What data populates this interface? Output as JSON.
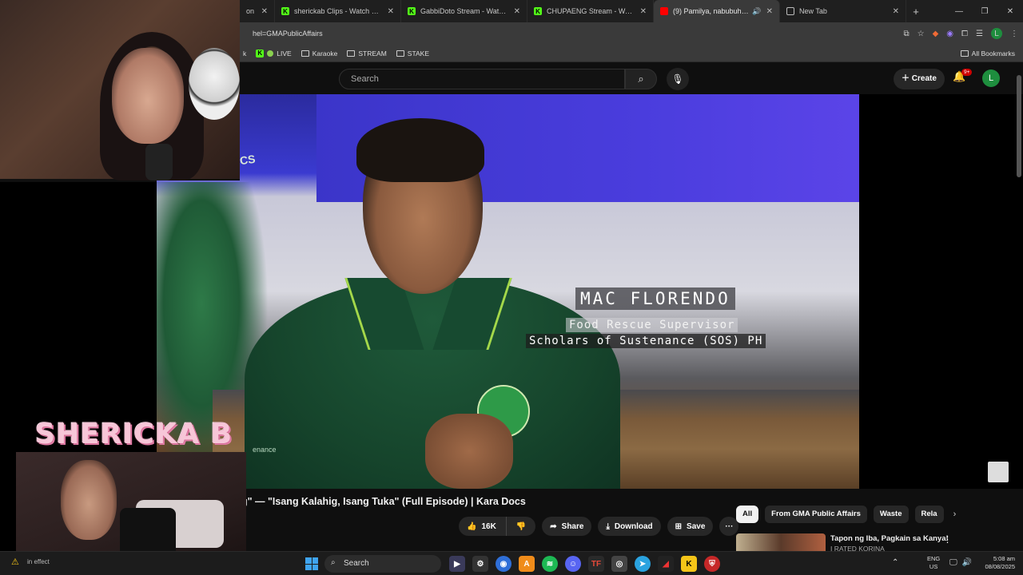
{
  "browser": {
    "tabs": [
      {
        "label": "on",
        "icon": "globe-icon",
        "active": false
      },
      {
        "label": "sherickab Clips - Watch Live on",
        "icon": "kick-icon",
        "active": false
      },
      {
        "label": "GabbiDoto Stream - Watch Live",
        "icon": "kick-icon",
        "active": false
      },
      {
        "label": "CHUPAENG Stream - Watch Live",
        "icon": "kick-icon",
        "active": false
      },
      {
        "label": "(9) Pamilya, nabubuhay lang",
        "icon": "youtube-icon",
        "active": true
      },
      {
        "label": "New Tab",
        "icon": "globe-icon",
        "active": false
      }
    ],
    "new_tab": "+",
    "address": "hel=GMAPublicAffairs",
    "profile_initial": "L",
    "bookmarks": [
      {
        "label": "k",
        "icon": "kick-icon"
      },
      {
        "label": "LIVE",
        "icon": "kick-icon"
      },
      {
        "label": "Karaoke",
        "icon": "folder-icon"
      },
      {
        "label": "STREAM",
        "icon": "folder-icon"
      },
      {
        "label": "STAKE",
        "icon": "folder-icon"
      }
    ],
    "all_bookmarks": "All Bookmarks"
  },
  "youtube": {
    "search_placeholder": "Search",
    "create_label": "Create",
    "notif_badge": "9+",
    "account_initial": "L"
  },
  "video": {
    "lower_third_name": "MAC FLORENDO",
    "lower_third_role": "Food Rescue Supervisor",
    "lower_third_org": "Scholars of Sustenance (SOS) PH",
    "watermark_left": "CS",
    "watermark_chest": "enance",
    "title": "g\" — \"Isang Kalahig, Isang Tuka\" (Full Episode) | Kara Docs",
    "actions": {
      "likes": "16K",
      "share": "Share",
      "download": "Download",
      "save": "Save",
      "more": "···"
    }
  },
  "recommendations": {
    "chips": [
      "All",
      "From GMA Public Affairs",
      "Waste",
      "Rela"
    ],
    "items": [
      {
        "title": "Tapon ng Iba, Pagkain sa Kanya!",
        "channel": "I RATED KORINA"
      }
    ]
  },
  "overlay": {
    "streamer_name": "SHERICKA B"
  },
  "taskbar": {
    "effect_text": "in effect",
    "search_label": "Search",
    "lang_top": "ENG",
    "lang_bottom": "US",
    "time": "5:08 am",
    "date": "08/08/2025"
  },
  "colors": {
    "accent_red": "#cc0000",
    "kick_green": "#53fc18",
    "account_green": "#1e8e3e"
  }
}
